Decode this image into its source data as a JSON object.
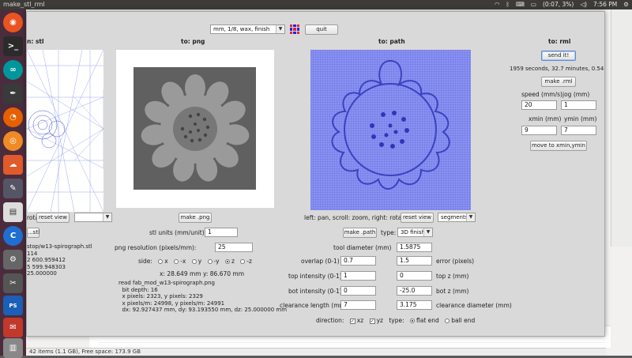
{
  "window_title": "make_stl_rml",
  "tray": {
    "battery": "(0:07, 3%)",
    "clock": "7:56 PM"
  },
  "status_bar": "42 items (1.1 GB), Free space: 173.9 GB",
  "toolbar": {
    "process_select": "mm, 1/8, wax, finish",
    "quit_label": "quit"
  },
  "stl": {
    "header": "n: stl",
    "reset_view_label": "reset view",
    "rotate_label": "rotate",
    "open_stl_label": "...stl",
    "info_lines": [
      "stop/w13-spirograph.stl",
      "114",
      "2 600.959412",
      "5 599.948303",
      "25.000000"
    ]
  },
  "png": {
    "header": "to: png",
    "make_png_label": "make .png",
    "stl_units_label": "stl units (mm/unit):",
    "stl_units_value": "1",
    "png_resolution_label": "png resolution (pixels/mm):",
    "png_resolution_value": "25",
    "side_label": "side:",
    "sides": [
      "x",
      "-x",
      "y",
      "-y",
      "z",
      "-z"
    ],
    "side_selected": "z",
    "coords": "x: 28.649 mm  y: 86.670 mm",
    "info_lines": [
      "read fab_mod_w13-spirograph.png",
      "  bit depth: 16",
      "  x pixels: 2323, y pixels: 2329",
      "  x pixels/m: 24998, y pixels/m: 24991",
      "  dx: 92.927437 mm, dy: 93.193550 mm, dz: 25.000000 mm"
    ]
  },
  "path": {
    "header": "to: path",
    "nav_hint": "left: pan, scroll: zoom, right: rotate",
    "reset_view_label": "reset view",
    "view_select": "segments",
    "make_path_label": "make .path",
    "type_label": "type:",
    "type_select": "3D finish",
    "tool_diameter_label": "tool diameter (mm)",
    "tool_diameter_value": "1.5875",
    "overlap_label": "overlap (0-1)",
    "overlap_value": "0.7",
    "error_label": "error (pixels)",
    "error_value": "1.5",
    "top_intensity_label": "top intensity (0-1)",
    "top_intensity_value": "1",
    "top_z_label": "top z (mm)",
    "top_z_value": "0",
    "bot_intensity_label": "bot intensity (0-1)",
    "bot_intensity_value": "0",
    "bot_z_label": "bot z (mm)",
    "bot_z_value": "-25.0",
    "clearance_length_label": "clearance length (mm)",
    "clearance_length_value": "7",
    "clearance_diameter_label": "clearance diameter (mm)",
    "clearance_diameter_value": "3.175",
    "direction_label": "direction:",
    "dir_xz": "xz",
    "dir_yz": "yz",
    "type2_label": "type:",
    "flat_end": "flat end",
    "ball_end": "ball end"
  },
  "rml": {
    "header": "to: rml",
    "send_label": "send it!",
    "estimate": "1959 seconds, 32.7 minutes, 0.54 hours",
    "make_rml_label": "make .rml",
    "speed_label": "speed (mm/s)",
    "speed_value": "20",
    "jog_label": "jog (mm)",
    "jog_value": "1",
    "xmin_label": "xmin (mm)",
    "xmin_value": "9",
    "ymin_label": "ymin (mm)",
    "ymin_value": "7",
    "move_label": "move to xmin,ymin"
  }
}
